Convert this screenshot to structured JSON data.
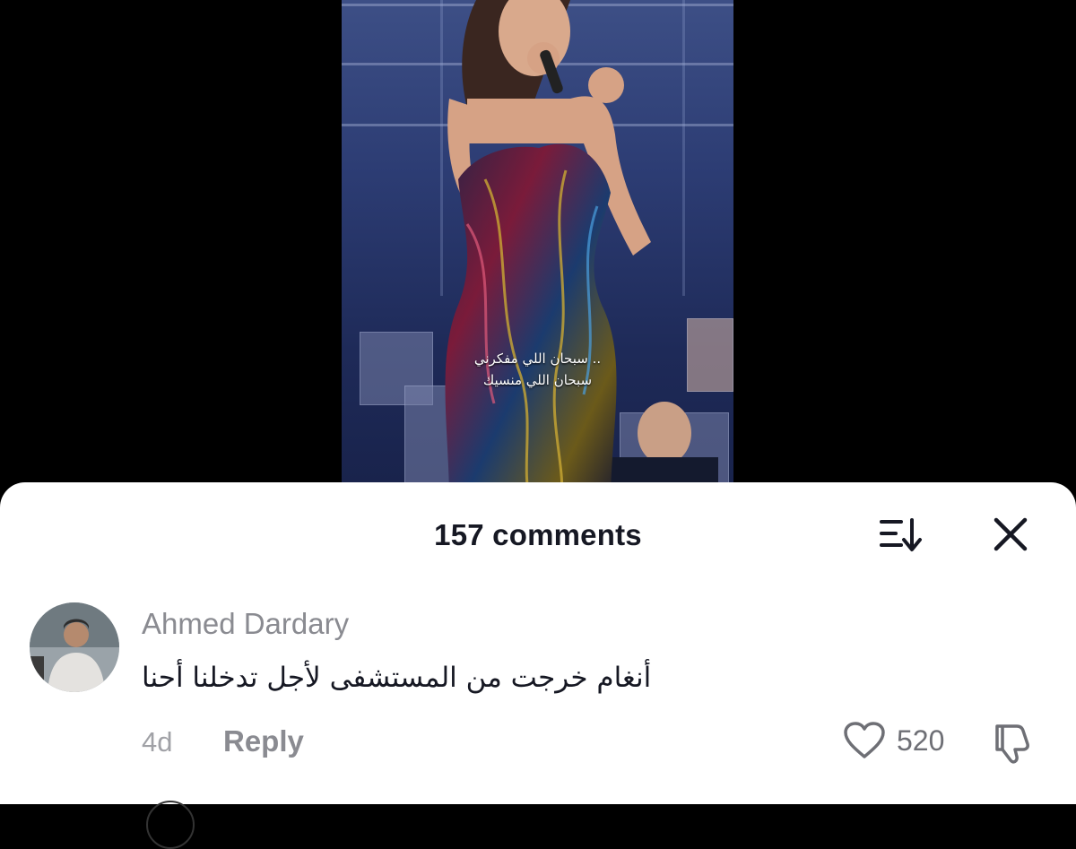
{
  "video": {
    "subtitle_line1": "سبحان اللي مفكرني ..",
    "subtitle_line2": "سبحان اللي منسيك"
  },
  "comments_panel": {
    "title": "157 comments",
    "sort_icon": "sort-icon",
    "close_icon": "close-icon"
  },
  "comments": [
    {
      "username": "Ahmed Dardary",
      "text": "أنغام خرجت من المستشفى لأجل تدخلنا أحنا",
      "time": "4d",
      "reply_label": "Reply",
      "likes": "520",
      "like_icon": "heart-icon",
      "dislike_icon": "thumbs-down-icon"
    }
  ],
  "colors": {
    "background": "#000000",
    "sheet": "#ffffff",
    "primary_text": "#161823",
    "secondary_text": "#8a8b91"
  }
}
